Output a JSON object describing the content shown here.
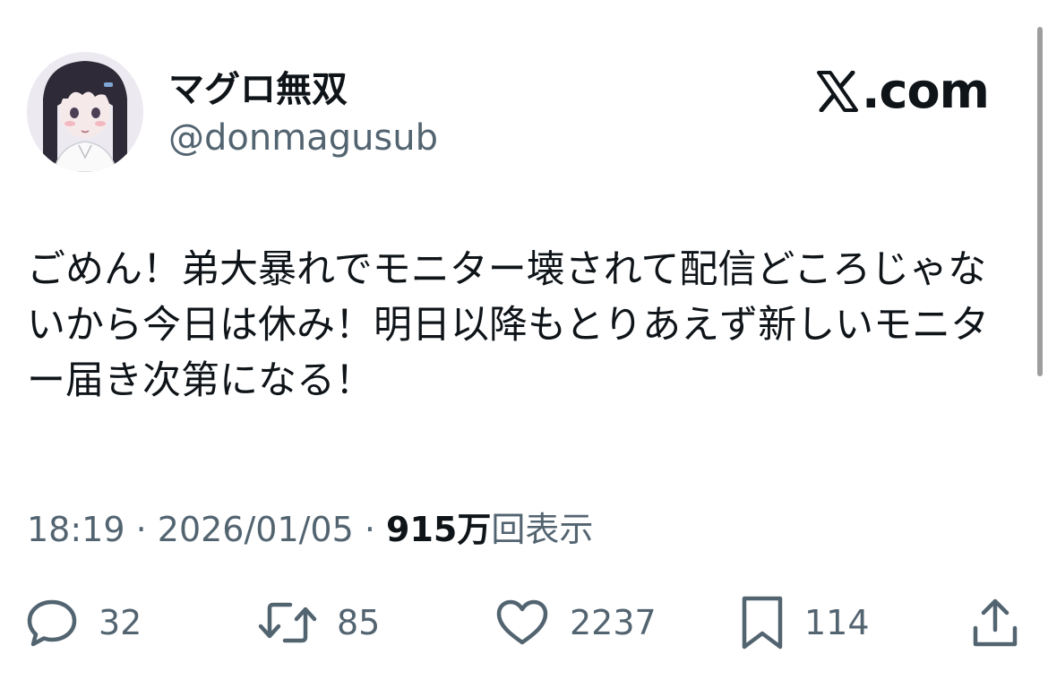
{
  "author": {
    "display_name": "マグロ無双",
    "handle": "@donmagusub"
  },
  "brand": {
    "text": ".com",
    "icon": "x-logo-icon"
  },
  "tweet": {
    "text": "ごめん！弟大暴れでモニター壊されて配信どころじゃないから今日は休み！明日以降もとりあえず新しいモニター届き次第になる！"
  },
  "meta": {
    "time": "18:19",
    "separator": " · ",
    "date": "2026/01/05",
    "views_count": "915万",
    "views_label": "回表示"
  },
  "actions": {
    "reply": {
      "icon": "reply-icon",
      "count": "32"
    },
    "retweet": {
      "icon": "retweet-icon",
      "count": "85"
    },
    "like": {
      "icon": "heart-icon",
      "count": "2237"
    },
    "bookmark": {
      "icon": "bookmark-icon",
      "count": "114"
    },
    "share": {
      "icon": "share-icon"
    }
  },
  "colors": {
    "text_primary": "#0f1419",
    "text_secondary": "#536471"
  }
}
